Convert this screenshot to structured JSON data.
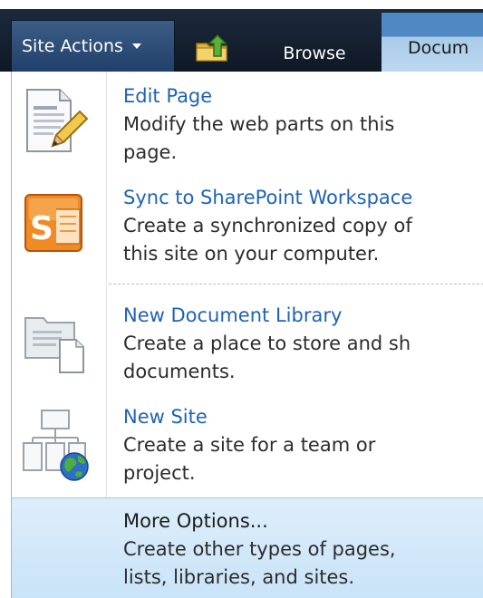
{
  "ribbon": {
    "site_actions_label": "Site Actions",
    "tabs": [
      {
        "label": "Browse"
      },
      {
        "label": "Docum"
      }
    ]
  },
  "menu": {
    "items": [
      {
        "title": "Edit Page",
        "desc_lines": [
          "Modify the web parts on this",
          "page."
        ],
        "icon": "edit-page-icon"
      },
      {
        "title": "Sync to SharePoint Workspace",
        "desc_lines": [
          "Create a synchronized copy of",
          "this site on your computer."
        ],
        "icon": "sharepoint-workspace-icon"
      },
      {
        "title": "New Document Library",
        "desc_lines": [
          "Create a place to store and sh",
          "documents."
        ],
        "icon": "document-library-icon"
      },
      {
        "title": "New Site",
        "desc_lines": [
          "Create a site for a team or",
          "project."
        ],
        "icon": "new-site-icon"
      }
    ],
    "more": {
      "title": "More Options...",
      "desc_lines": [
        "Create other types of pages,",
        "lists, libraries, and sites."
      ]
    }
  },
  "colors": {
    "link_blue": "#1f63b4",
    "ribbon_dark": "#1c2a3c",
    "hover_blue": "#c9e3f8"
  }
}
